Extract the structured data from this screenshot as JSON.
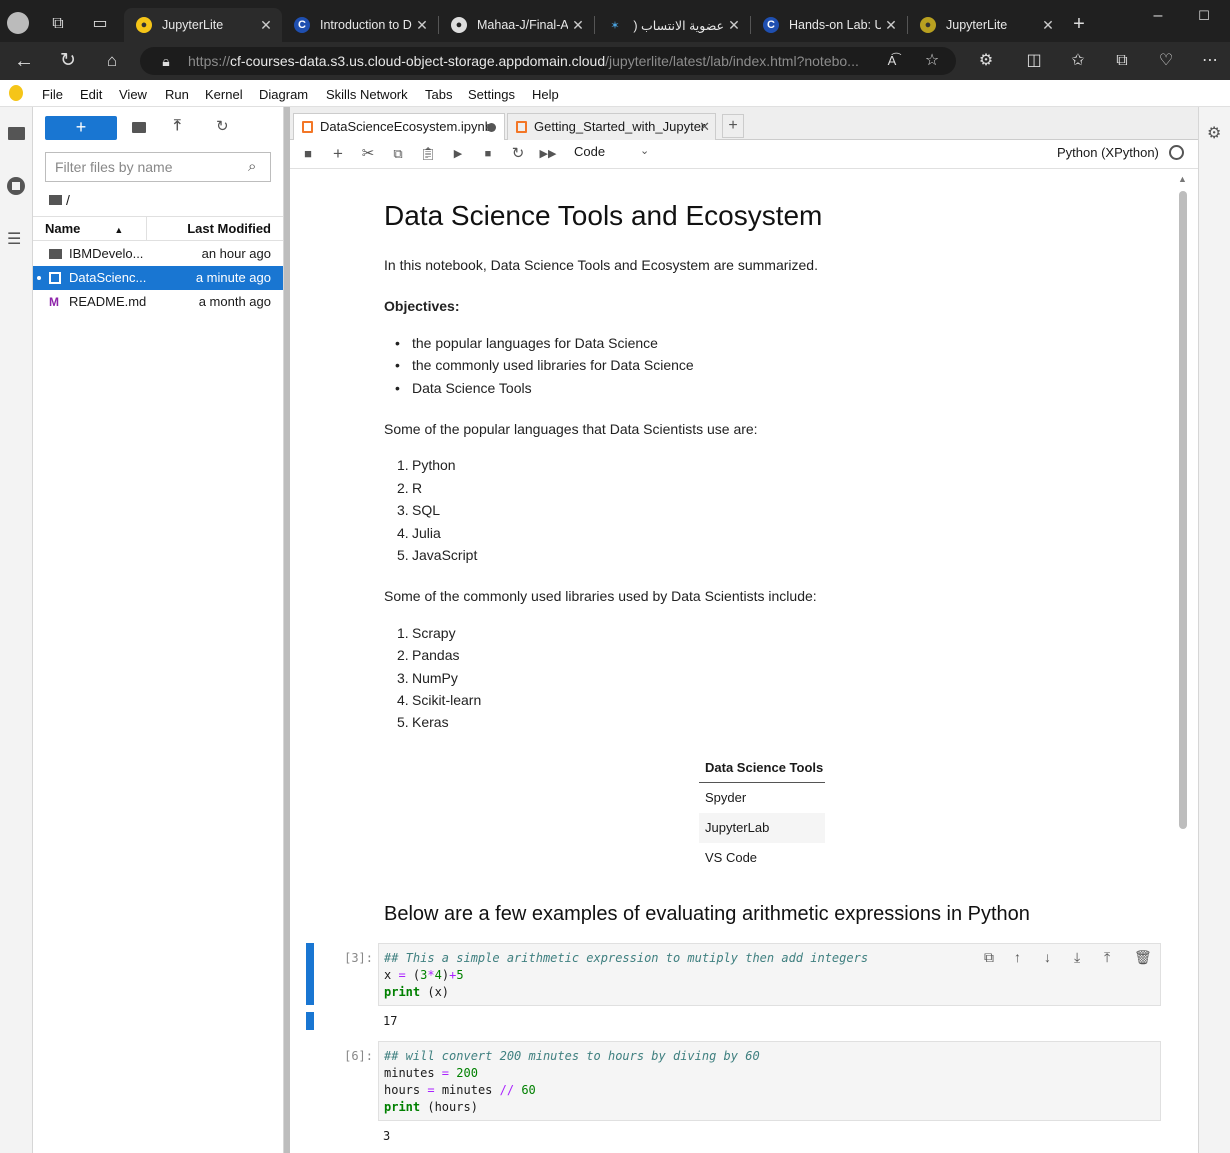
{
  "browser": {
    "tabs": [
      {
        "title": "JupyterLite",
        "favicon": "jupyter-icon",
        "active": true
      },
      {
        "title": "Introduction to D",
        "favicon": "coursera-icon"
      },
      {
        "title": "Mahaa-J/Final-As",
        "favicon": "github-icon"
      },
      {
        "title": "عضوية الانتساب (",
        "favicon": "membership-icon"
      },
      {
        "title": "Hands-on Lab: U",
        "favicon": "coursera-icon"
      },
      {
        "title": "JupyterLite",
        "favicon": "jupyter-icon"
      }
    ],
    "url_prefix": "https://",
    "url_host": "cf-courses-data.s3.us.cloud-object-storage.appdomain.cloud",
    "url_path": "/jupyterlite/latest/lab/index.html?notebo..."
  },
  "menu": [
    "File",
    "Edit",
    "View",
    "Run",
    "Kernel",
    "Diagram",
    "Skills Network",
    "Tabs",
    "Settings",
    "Help"
  ],
  "filebrowser": {
    "new_label": "+",
    "filter_placeholder": "Filter files by name",
    "path": "/",
    "col_name": "Name",
    "col_modified": "Last Modified",
    "files": [
      {
        "name": "IBMDevelo...",
        "modified": "an hour ago",
        "type": "folder"
      },
      {
        "name": "DataScienc...",
        "modified": "a minute ago",
        "type": "notebook",
        "selected": true
      },
      {
        "name": "README.md",
        "modified": "a month ago",
        "type": "markdown"
      }
    ]
  },
  "notebook": {
    "tabs": [
      {
        "title": "DataScienceEcosystem.ipynb",
        "active": true,
        "dirty": true
      },
      {
        "title": "Getting_Started_with_Jupyter"
      }
    ],
    "celltype": "Code",
    "kernel": "Python (XPython)",
    "title": "Data Science Tools and Ecosystem",
    "intro": "In this notebook, Data Science Tools and Ecosystem are summarized.",
    "objectives_label": "Objectives:",
    "objectives": [
      "the popular languages for Data Science",
      "the commonly used libraries for Data Science",
      "Data Science Tools"
    ],
    "languages_intro": "Some of the popular languages that Data Scientists use are:",
    "languages": [
      "Python",
      "R",
      "SQL",
      "Julia",
      "JavaScript"
    ],
    "libraries_intro": "Some of the commonly used libraries used by Data Scientists include:",
    "libraries": [
      "Scrapy",
      "Pandas",
      "NumPy",
      "Scikit-learn",
      "Keras"
    ],
    "tools_header": "Data Science Tools",
    "tools": [
      "Spyder",
      "JupyterLab",
      "VS Code"
    ],
    "examples_heading": "Below are a few examples of evaluating arithmetic expressions in Python",
    "cell1": {
      "prompt": "[3]:",
      "comment": "## This a simple arithmetic expression to mutiply then add integers",
      "output": "17"
    },
    "cell2": {
      "prompt": "[6]:",
      "comment": "##  will convert 200 minutes to hours by diving by 60",
      "output": "3"
    }
  },
  "colors": {
    "accent": "#1976d2",
    "jupyter_orange": "#f37626"
  }
}
